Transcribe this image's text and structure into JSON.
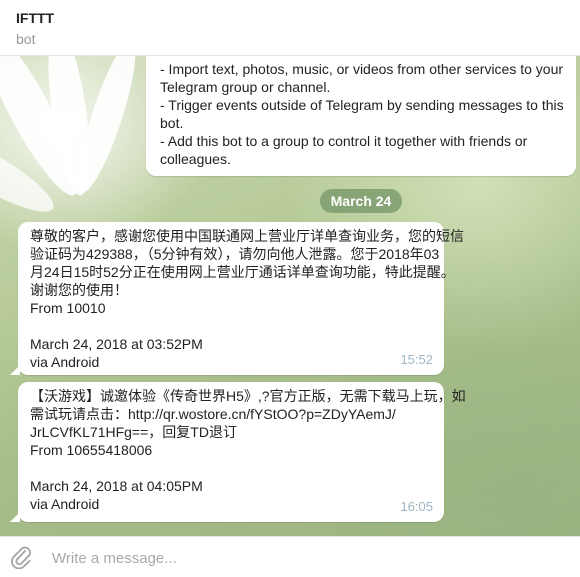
{
  "header": {
    "title": "IFTTT",
    "subtitle": "bot"
  },
  "bot_description": {
    "lines": [
      "- Import text, photos, music, or videos from other services to your",
      "Telegram group or channel.",
      "- Trigger events outside of Telegram by sending messages to this",
      "bot.",
      "- Add this bot to a group to control it together with friends or",
      "colleagues."
    ]
  },
  "date_separator": "March 24",
  "messages": [
    {
      "lines": [
        "尊敬的客户，感谢您使用中国联通网上营业厅详单查询业务，您的短信",
        "验证码为429388，（5分钟有效），请勿向他人泄露。您于2018年03",
        "月24日15时52分正在使用网上营业厅通话详单查询功能，特此提醒。",
        "谢谢您的使用！",
        "From 10010",
        "",
        "March 24, 2018 at 03:52PM",
        "via Android"
      ],
      "time": "15:52"
    },
    {
      "lines": [
        "【沃游戏】诚邀体验《传奇世界H5》,?官方正版，无需下载马上玩，如",
        "需试玩请点击：http://qr.wostore.cn/fYStOO?p=ZDyYAemJ/",
        "JrLCVfKL71HFg==，回复TD退订",
        "From 10655418006",
        "",
        "March 24, 2018 at 04:05PM",
        "via Android"
      ],
      "time": "16:05"
    }
  ],
  "composer": {
    "placeholder": "Write a message...",
    "attach_icon": "paperclip-icon"
  }
}
